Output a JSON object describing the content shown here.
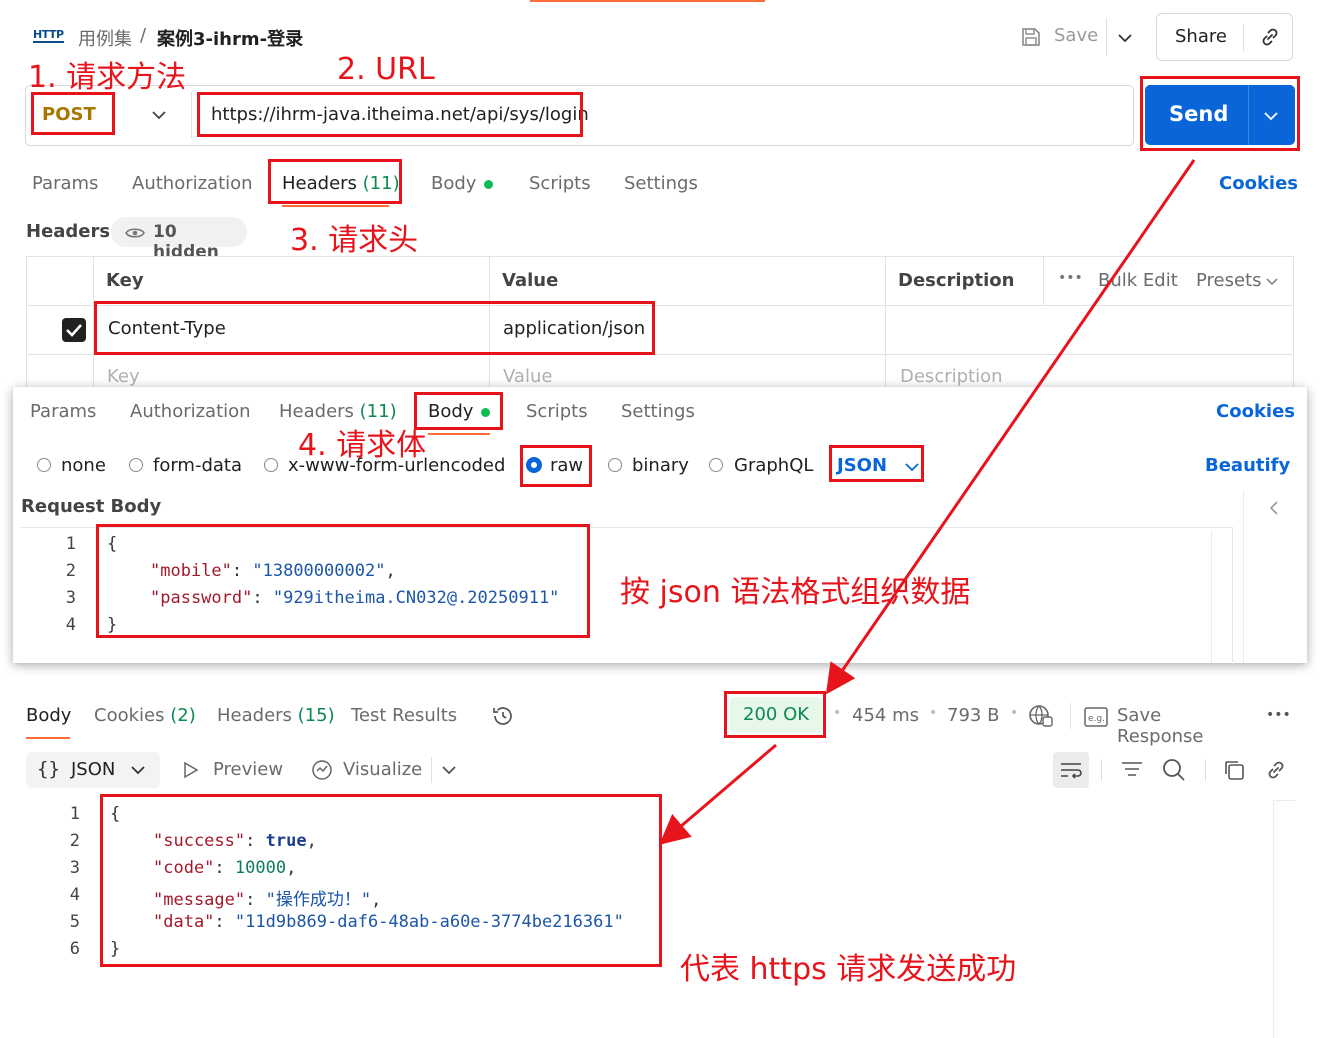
{
  "breadcrumb": {
    "icon_text": "HTTP",
    "collection": "用例集",
    "separator": "/",
    "request": "案例3-ihrm-登录"
  },
  "toolbar": {
    "save_label": "Save",
    "share_label": "Share"
  },
  "request": {
    "method": "POST",
    "url": "https://ihrm-java.itheima.net/api/sys/login",
    "send_label": "Send"
  },
  "tabs_top": {
    "params": "Params",
    "authorization": "Authorization",
    "headers": "Headers",
    "headers_count": "(11)",
    "body": "Body",
    "scripts": "Scripts",
    "settings": "Settings",
    "cookies": "Cookies"
  },
  "headers_section": {
    "title": "Headers",
    "hidden": "10 hidden",
    "columns": {
      "key": "Key",
      "value": "Value",
      "description": "Description",
      "bulk_edit": "Bulk Edit",
      "presets": "Presets"
    },
    "row": {
      "key": "Content-Type",
      "value": "application/json"
    },
    "placeholder": {
      "key": "Key",
      "value": "Value",
      "description": "Description"
    }
  },
  "tabs_body": {
    "params": "Params",
    "authorization": "Authorization",
    "headers": "Headers",
    "headers_count": "(11)",
    "body": "Body",
    "scripts": "Scripts",
    "settings": "Settings",
    "cookies": "Cookies"
  },
  "body_types": {
    "none": "none",
    "form_data": "form-data",
    "urlencoded": "x-www-form-urlencoded",
    "raw": "raw",
    "binary": "binary",
    "graphql": "GraphQL",
    "format": "JSON",
    "beautify": "Beautify"
  },
  "request_body": {
    "title": "Request Body",
    "line_numbers": [
      "1",
      "2",
      "3",
      "4"
    ],
    "open": "{",
    "mobile_key": "\"mobile\"",
    "mobile_value": "\"13800000002\"",
    "password_key": "\"password\"",
    "password_value": "\"929itheima.CN032@.20250911\"",
    "close": "}"
  },
  "response": {
    "tabs": {
      "body": "Body",
      "cookies": "Cookies",
      "cookies_count": "(2)",
      "headers": "Headers",
      "headers_count": "(15)",
      "test_results": "Test Results"
    },
    "status": "200 OK",
    "time": "454 ms",
    "size": "793 B",
    "save_response": "Save Response",
    "format": "JSON",
    "preview": "Preview",
    "visualize": "Visualize",
    "line_numbers": [
      "1",
      "2",
      "3",
      "4",
      "5",
      "6"
    ],
    "open": "{",
    "success_key": "\"success\"",
    "success_value": "true",
    "code_key": "\"code\"",
    "code_value": "10000",
    "message_key": "\"message\"",
    "message_value": "\"操作成功！\"",
    "data_key": "\"data\"",
    "data_value": "\"11d9b869-daf6-48ab-a60e-3774be216361\"",
    "close": "}"
  },
  "annotations": {
    "method": "1. 请求方法",
    "url": "2. URL",
    "headers": "3. 请求头",
    "body": "4. 请求体",
    "json_note": "按 json 语法格式组织数据",
    "success_note": "代表 https 请求发送成功"
  },
  "colors": {
    "accent": "#0a66d8",
    "annotation_red": "#e8141b",
    "status_green": "#0c8a4f"
  }
}
